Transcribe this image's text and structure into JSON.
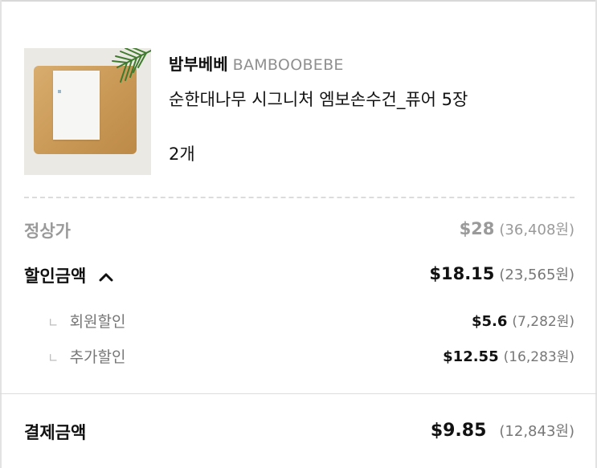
{
  "product": {
    "brand_kr": "밤부베베",
    "brand_en": "BAMBOOBEBE",
    "name": "순한대나무 시그니처 엠보손수건_퓨어 5장",
    "quantity": "2개"
  },
  "summary": {
    "regular_price": {
      "label": "정상가",
      "usd": "$28",
      "krw": "(36,408원)"
    },
    "discount": {
      "label": "할인금액",
      "expanded": true,
      "usd": "$18.15",
      "krw": "(23,565원)",
      "items": [
        {
          "label": "회원할인",
          "usd": "$5.6",
          "krw": "(7,282원)"
        },
        {
          "label": "추가할인",
          "usd": "$12.55",
          "krw": "(16,283원)"
        }
      ]
    },
    "total": {
      "label": "결제금액",
      "usd": "$9.85",
      "krw": "(12,843원)"
    }
  },
  "icons": {
    "caret": "chevron-up-icon",
    "sub_marker": "corner-marker-icon"
  },
  "colors": {
    "text": "#111111",
    "muted": "#9a9a9a",
    "divider": "#dcdcdc"
  }
}
